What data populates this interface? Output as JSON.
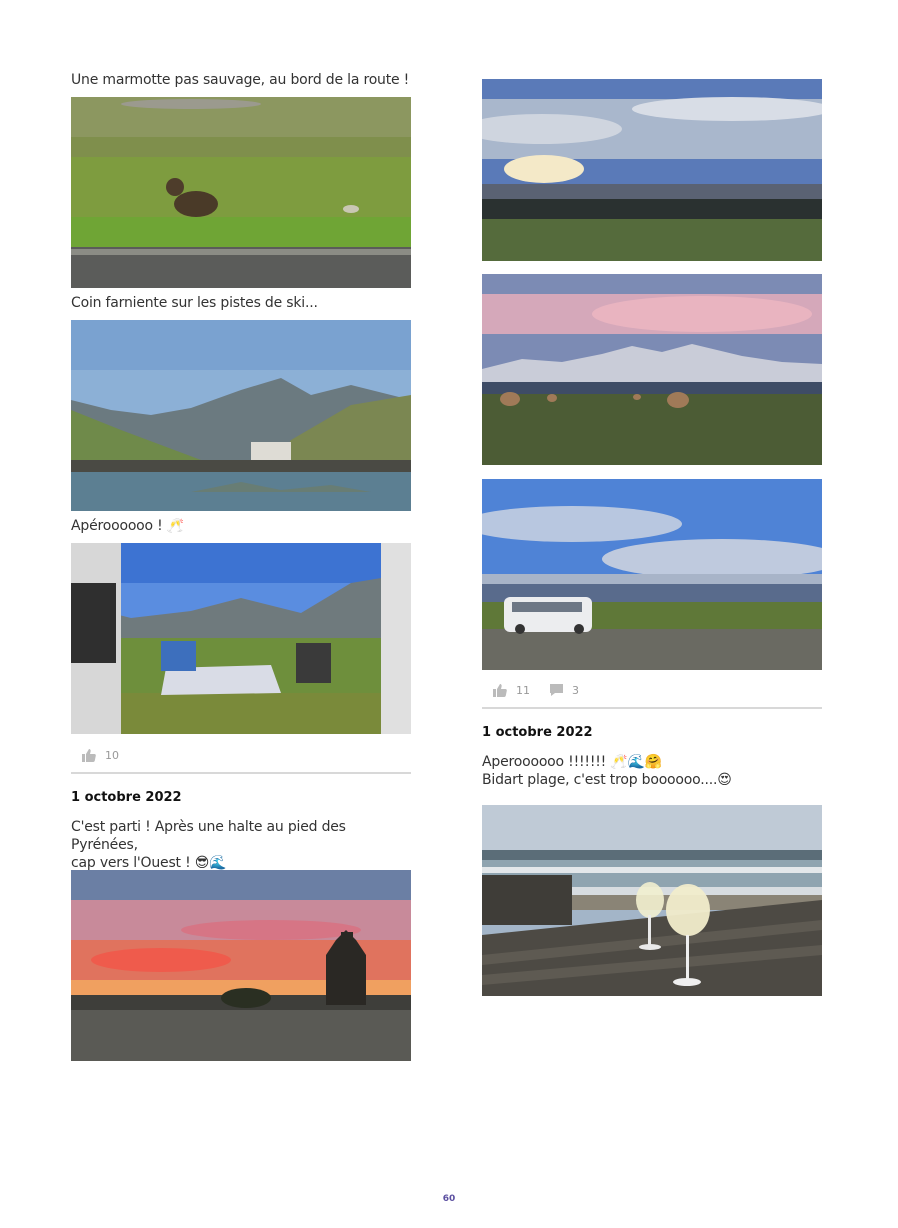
{
  "left_column": {
    "caption_1": "Une marmotte pas sauvage, au bord de la route !",
    "caption_2": "Coin farniente sur les pistes de ski...",
    "caption_3": "Apéroooooo ! 🥂",
    "post_1_likes": "10",
    "post_2_date": "1 octobre 2022",
    "post_2_text": "C'est parti ! Après une halte au pied des Pyrénées,\ncap vers l'Ouest ! 😎🌊"
  },
  "right_column": {
    "post_2_likes": "11",
    "post_2_comments": "3",
    "post_3_date": "1 octobre 2022",
    "post_3_text": "Aperoooooo !!!!!!! 🥂🌊🤗\nBidart plage, c'est trop boooooo....😍"
  },
  "icons": {
    "like": "thumbs-up-icon",
    "comment": "speech-bubble-icon"
  },
  "colors": {
    "page_number": "#5b4fa0",
    "divider": "#d8d8d8"
  },
  "footer": {
    "page_number": "60"
  }
}
